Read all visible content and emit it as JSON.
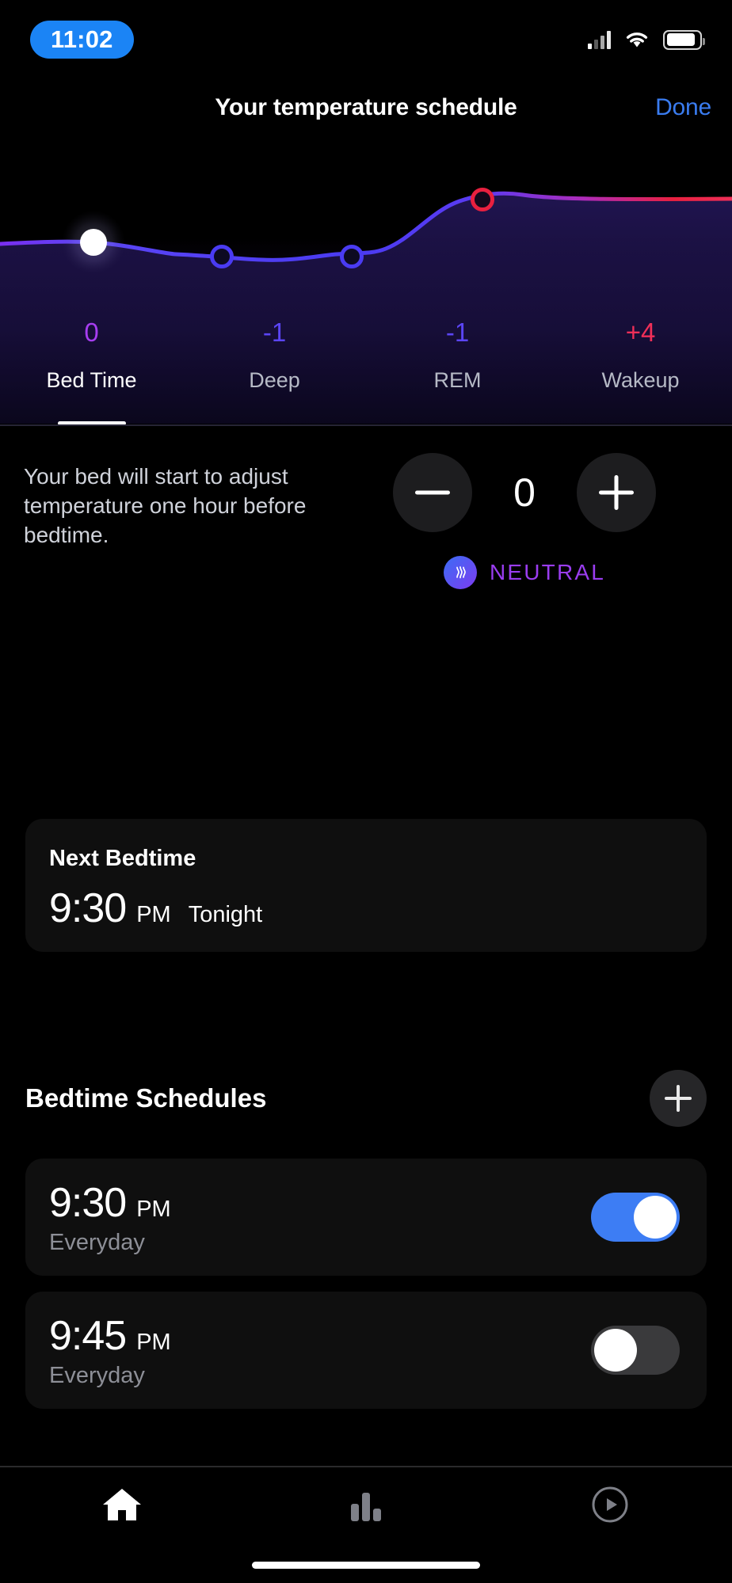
{
  "status_bar": {
    "time": "11:02",
    "signal_icon": "cellular-signal-icon",
    "wifi_icon": "wifi-icon",
    "battery_icon": "battery-icon"
  },
  "nav": {
    "title": "Your temperature schedule",
    "done_label": "Done"
  },
  "chart_data": {
    "type": "line",
    "title": "Your temperature schedule",
    "xlabel": "",
    "ylabel": "",
    "categories": [
      "Bed Time",
      "Deep",
      "REM",
      "Wakeup"
    ],
    "values": [
      0,
      -1,
      -1,
      4
    ],
    "value_labels": [
      "0",
      "-1",
      "-1",
      "+4"
    ],
    "value_colors": [
      "#a63df0",
      "#5b45f5",
      "#5b45f5",
      "#ef2f58"
    ],
    "point_colors": [
      "#ffffff",
      "#4a3bf2",
      "#4a3bf2",
      "#e8203f"
    ],
    "selected_index": 0,
    "grid": false,
    "legend": "none",
    "line_gradient": [
      "#7a2ef0",
      "#4a3bf2",
      "#4a3bf2",
      "#e8203f"
    ],
    "ylim": [
      -2,
      5
    ]
  },
  "tabs": [
    {
      "label": "Bed Time",
      "active": true
    },
    {
      "label": "Deep",
      "active": false
    },
    {
      "label": "REM",
      "active": false
    },
    {
      "label": "Wakeup",
      "active": false
    }
  ],
  "adjust": {
    "description": "Your bed will start to adjust temperature one hour before bedtime.",
    "minus_label": "minus",
    "plus_label": "plus",
    "value": "0",
    "status_label": "NEUTRAL",
    "status_color": "#9a3df0",
    "status_icon": "heat-waves-icon"
  },
  "next_bedtime": {
    "label": "Next Bedtime",
    "time": "9:30",
    "ampm": "PM",
    "when": "Tonight"
  },
  "schedules_section": {
    "title": "Bedtime Schedules",
    "add_icon": "plus-icon",
    "items": [
      {
        "time": "9:30",
        "ampm": "PM",
        "days": "Everyday",
        "enabled": true
      },
      {
        "time": "9:45",
        "ampm": "PM",
        "days": "Everyday",
        "enabled": false
      }
    ]
  },
  "tabbar": {
    "items": [
      {
        "icon": "home-icon",
        "active": true
      },
      {
        "icon": "bar-chart-icon",
        "active": false
      },
      {
        "icon": "play-circle-icon",
        "active": false
      }
    ]
  },
  "colors": {
    "accent_blue": "#3d7df4",
    "background": "#000000",
    "card": "#0f0f0f",
    "purple": "#9a3df0",
    "red": "#ef2f58"
  }
}
